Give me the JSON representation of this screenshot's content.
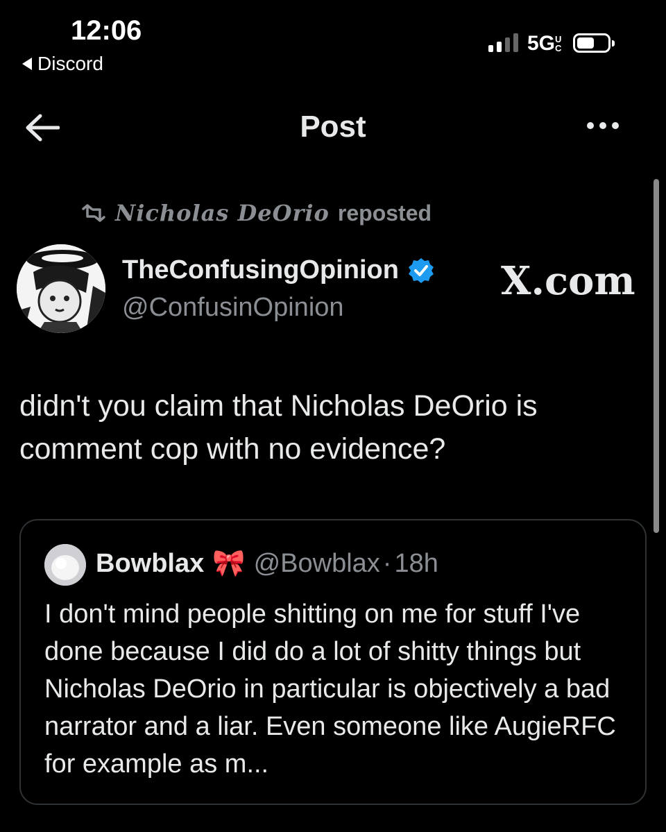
{
  "status_bar": {
    "time": "12:06",
    "back_app": "Discord",
    "network": "5G",
    "network_suffix": "UC"
  },
  "header": {
    "title": "Post"
  },
  "repost": {
    "user": "Nicholas DeOrio",
    "label": "reposted"
  },
  "post": {
    "display_name": "TheConfusingOpinion",
    "handle": "@ConfusinOpinion",
    "watermark": "X.com",
    "text": "didn't you claim that Nicholas DeOrio is comment cop with no evidence?",
    "verified_color": "#1d9bf0"
  },
  "quote": {
    "display_name": "Bowblax",
    "emoji": "🎀",
    "handle": "@Bowblax",
    "separator": "·",
    "time": "18h",
    "text": "I don't mind people shitting on me for stuff I've done because I did do a lot of shitty things but Nicholas DeOrio in particular is objectively a bad narrator and a liar. Even someone like AugieRFC for example as m..."
  },
  "icons": {
    "back": "arrow-left-icon",
    "more": "more-horizontal-icon",
    "repost": "repost-icon",
    "verified": "verified-badge-icon"
  }
}
